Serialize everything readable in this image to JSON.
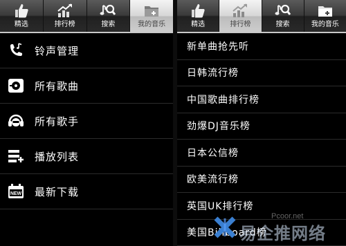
{
  "left_tabs": [
    {
      "label": "精选",
      "icon": "thumbs-up-icon",
      "active": false
    },
    {
      "label": "排行榜",
      "icon": "trend-chart-icon",
      "active": false
    },
    {
      "label": "搜索",
      "icon": "music-search-icon",
      "active": false
    },
    {
      "label": "我的音乐",
      "icon": "folder-plus-icon",
      "active": true
    }
  ],
  "right_tabs": [
    {
      "label": "精选",
      "icon": "thumbs-up-icon",
      "active": false
    },
    {
      "label": "排行榜",
      "icon": "trend-chart-icon",
      "active": true
    },
    {
      "label": "搜索",
      "icon": "music-search-icon",
      "active": false
    },
    {
      "label": "我的音乐",
      "icon": "folder-plus-icon",
      "active": false
    }
  ],
  "my_music_items": [
    {
      "label": "铃声管理",
      "icon": "phone-music-icon"
    },
    {
      "label": "所有歌曲",
      "icon": "disc-icon"
    },
    {
      "label": "所有歌手",
      "icon": "singer-headphones-icon"
    },
    {
      "label": "播放列表",
      "icon": "playlist-icon"
    },
    {
      "label": "最新下载",
      "icon": "new-calendar-icon"
    }
  ],
  "chart_items": [
    {
      "label": "新单曲抢先听"
    },
    {
      "label": "日韩流行榜"
    },
    {
      "label": "中国歌曲排行榜"
    },
    {
      "label": "劲爆DJ音乐榜"
    },
    {
      "label": "日本公信榜"
    },
    {
      "label": "欧美流行榜"
    },
    {
      "label": "英国UK排行榜"
    },
    {
      "label": "美国Billboard榜"
    }
  ],
  "watermark": {
    "text": "易企推网络",
    "url": "Pcoor.net",
    "new_badge": "NEW"
  },
  "colors": {
    "background": "#000000",
    "tab_active": "#d6d6d6",
    "divider": "#2c2c2c",
    "icon": "#ffffff"
  }
}
